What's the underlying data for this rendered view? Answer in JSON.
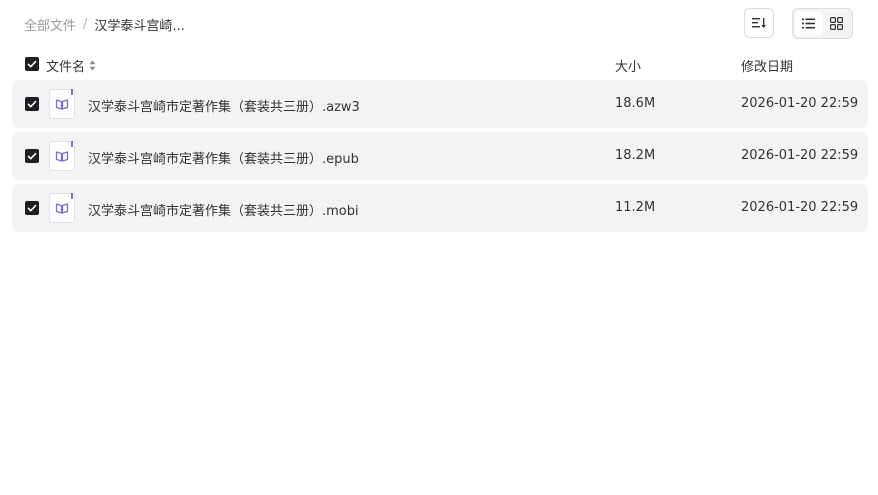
{
  "breadcrumb": {
    "root": "全部文件",
    "separator": "/",
    "current": "汉学泰斗宫崎..."
  },
  "toolbar": {
    "sort_icon": "sort-icon",
    "view_list_icon": "list-view-icon",
    "view_grid_icon": "grid-view-icon",
    "active_view": "list"
  },
  "table": {
    "header": {
      "name": "文件名",
      "size": "大小",
      "modified": "修改日期",
      "select_all_checked": true
    },
    "rows": [
      {
        "name": "汉学泰斗宫崎市定著作集（套装共三册）.azw3",
        "size": "18.6M",
        "modified": "2026-01-20 22:59",
        "checked": true,
        "icon": "ebook-icon"
      },
      {
        "name": "汉学泰斗宫崎市定著作集（套装共三册）.epub",
        "size": "18.2M",
        "modified": "2026-01-20 22:59",
        "checked": true,
        "icon": "ebook-icon"
      },
      {
        "name": "汉学泰斗宫崎市定著作集（套装共三册）.mobi",
        "size": "11.2M",
        "modified": "2026-01-20 22:59",
        "checked": true,
        "icon": "ebook-icon"
      }
    ]
  },
  "colors": {
    "row_background": "#f3f3f4",
    "checkbox_fill": "#1f1f23",
    "ebook_icon_accent": "#7b6fd6"
  }
}
